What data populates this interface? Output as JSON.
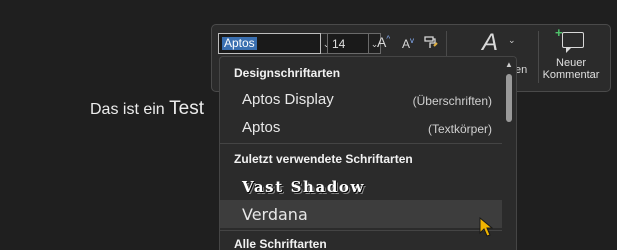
{
  "document": {
    "text_prefix": "Das ist ein ",
    "text_emphasis": "Test"
  },
  "toolbar": {
    "font_name_value": "Aptos",
    "font_size_value": "14",
    "grow_font_glyph": "A",
    "shrink_font_glyph": "A",
    "styles_partial_label": "en",
    "new_comment_label": "Neuer Kommentar"
  },
  "dropdown": {
    "theme_fonts_header": "Designschriftarten",
    "theme_fonts": [
      {
        "name": "Aptos Display",
        "hint": "(Überschriften)"
      },
      {
        "name": "Aptos",
        "hint": "(Textkörper)"
      }
    ],
    "recent_fonts_header": "Zuletzt verwendete Schriftarten",
    "recent_fonts": [
      {
        "name": "Vast Shadow"
      },
      {
        "name": "Verdana"
      }
    ],
    "all_fonts_header": "Alle Schriftarten"
  },
  "icons": {
    "dropdown_chevron": "chevron-down-icon",
    "grow_font": "grow-font-icon",
    "shrink_font": "shrink-font-icon",
    "format_painter": "format-painter-icon",
    "styles": "styles-icon",
    "new_comment": "new-comment-icon",
    "cursor": "mouse-pointer-icon"
  },
  "colors": {
    "background": "#1f1f1f",
    "selection_highlight": "#3a6fb0",
    "hover_item": "#3d3d3d",
    "comment_plus": "#4fc36b",
    "cursor": "#f0b400"
  }
}
